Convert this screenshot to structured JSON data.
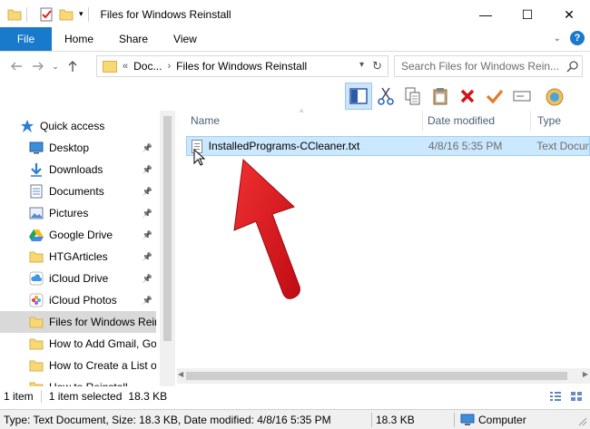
{
  "window": {
    "title": "Files for Windows Reinstall",
    "minimize_glyph": "—",
    "maximize_glyph": "☐",
    "close_glyph": "✕"
  },
  "ribbon": {
    "tabs": [
      "File",
      "Home",
      "Share",
      "View"
    ],
    "help_glyph": "?"
  },
  "address": {
    "overflow": "«",
    "crumbs": [
      "Doc...",
      "Files for Windows Reinstall"
    ],
    "search_placeholder": "Search Files for Windows Rein..."
  },
  "columns": {
    "name": "Name",
    "date": "Date modified",
    "type": "Type"
  },
  "nav": {
    "items": [
      {
        "label": "Quick access",
        "icon": "star-icon",
        "pinned": false
      },
      {
        "label": "Desktop",
        "icon": "desktop-icon",
        "pinned": true
      },
      {
        "label": "Downloads",
        "icon": "downloads-icon",
        "pinned": true
      },
      {
        "label": "Documents",
        "icon": "documents-icon",
        "pinned": true
      },
      {
        "label": "Pictures",
        "icon": "pictures-icon",
        "pinned": true
      },
      {
        "label": "Google Drive",
        "icon": "google-drive-icon",
        "pinned": true
      },
      {
        "label": "HTGArticles",
        "icon": "folder-icon",
        "pinned": true
      },
      {
        "label": "iCloud Drive",
        "icon": "icloud-icon",
        "pinned": true
      },
      {
        "label": "iCloud Photos",
        "icon": "icloud-photos-icon",
        "pinned": true
      },
      {
        "label": "Files for Windows Rein",
        "icon": "folder-icon",
        "pinned": false,
        "selected": true
      },
      {
        "label": "How to Add Gmail, Go",
        "icon": "folder-icon",
        "pinned": false
      },
      {
        "label": "How to Create a List of",
        "icon": "folder-icon",
        "pinned": false
      },
      {
        "label": "How to Reinstall",
        "icon": "folder-icon",
        "pinned": false
      }
    ]
  },
  "files": [
    {
      "name": "InstalledPrograms-CCleaner.txt",
      "date": "4/8/16 5:35 PM",
      "type": "Text Docum"
    }
  ],
  "status": {
    "count": "1 item",
    "selected": "1 item selected",
    "size": "18.3 KB"
  },
  "outer_status": {
    "info": "Type: Text Document, Size: 18.3 KB, Date modified: 4/8/16 5:35 PM",
    "size": "18.3 KB",
    "location": "Computer"
  },
  "colors": {
    "accent": "#1979ca",
    "selection": "#cce8ff",
    "arrow": "#e0141b"
  }
}
